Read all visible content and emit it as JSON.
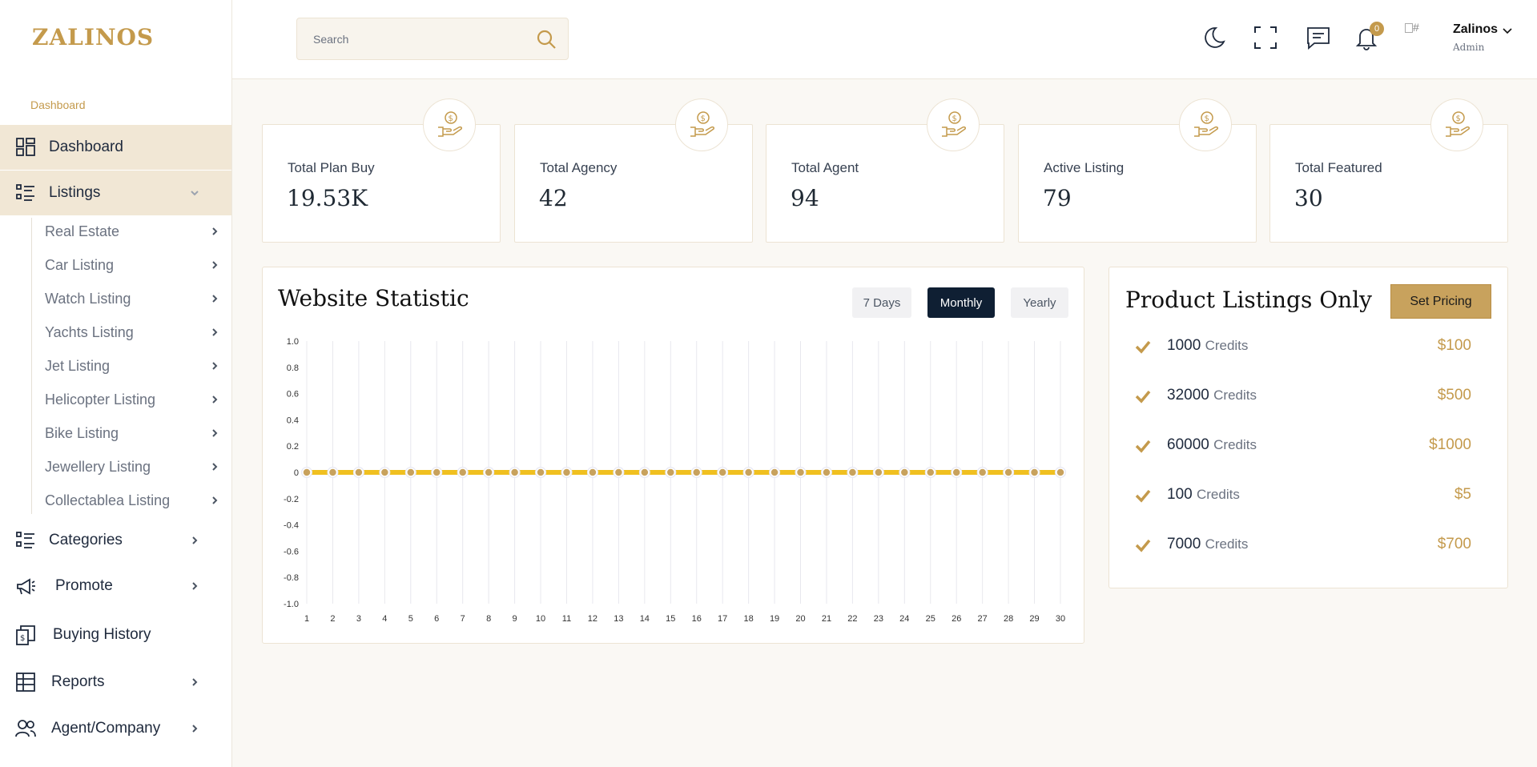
{
  "brand": {
    "logo_text": "ZALINOS"
  },
  "sidebar": {
    "section_label": "Dashboard",
    "items": [
      {
        "label": "Dashboard",
        "icon": "dashboard-grid-icon"
      },
      {
        "label": "Listings",
        "icon": "list-icon"
      },
      {
        "label": "Categories",
        "icon": "list-icon"
      },
      {
        "label": "Promote",
        "icon": "megaphone-icon"
      },
      {
        "label": "Buying History",
        "icon": "receipt-icon"
      },
      {
        "label": "Reports",
        "icon": "table-icon"
      },
      {
        "label": "Agent/Company",
        "icon": "users-icon"
      }
    ],
    "sub_items": [
      "Real Estate",
      "Car Listing",
      "Watch Listing",
      "Yachts Listing",
      "Jet Listing",
      "Helicopter Listing",
      "Bike Listing",
      "Jewellery Listing",
      "Collectablea Listing"
    ]
  },
  "header": {
    "search_placeholder": "Search",
    "notification_count": "0",
    "avatar_alt": "#",
    "user_name": "Zalinos",
    "user_role": "Admin"
  },
  "stats": [
    {
      "label": "Total Plan Buy",
      "value": "19.53K"
    },
    {
      "label": "Total Agency",
      "value": "42"
    },
    {
      "label": "Total Agent",
      "value": "94"
    },
    {
      "label": "Active Listing",
      "value": "79"
    },
    {
      "label": "Total Featured",
      "value": "30"
    }
  ],
  "statistic": {
    "title": "Website Statistic",
    "tabs": [
      "7 Days",
      "Monthly",
      "Yearly"
    ],
    "active_tab": "Monthly"
  },
  "chart_data": {
    "type": "line",
    "title": "",
    "xlabel": "",
    "ylabel": "",
    "x": [
      1,
      2,
      3,
      4,
      5,
      6,
      7,
      8,
      9,
      10,
      11,
      12,
      13,
      14,
      15,
      16,
      17,
      18,
      19,
      20,
      21,
      22,
      23,
      24,
      25,
      26,
      27,
      28,
      29,
      30
    ],
    "series": [
      {
        "values": [
          0,
          0,
          0,
          0,
          0,
          0,
          0,
          0,
          0,
          0,
          0,
          0,
          0,
          0,
          0,
          0,
          0,
          0,
          0,
          0,
          0,
          0,
          0,
          0,
          0,
          0,
          0,
          0,
          0,
          0
        ],
        "color": "#f0c020"
      }
    ],
    "yticks": [
      "1.0",
      "0.8",
      "0.6",
      "0.4",
      "0.2",
      "0",
      "-0.2",
      "-0.4",
      "-0.6",
      "-0.8",
      "-1.0"
    ],
    "ylim": [
      -1,
      1
    ],
    "grid": "vertical"
  },
  "listings": {
    "title": "Product Listings Only",
    "button_label": "Set Pricing",
    "credits_word": "Credits",
    "rows": [
      {
        "amount": "1000",
        "price": "$100"
      },
      {
        "amount": "32000",
        "price": "$500"
      },
      {
        "amount": "60000",
        "price": "$1000"
      },
      {
        "amount": "100",
        "price": "$5"
      },
      {
        "amount": "7000",
        "price": "$700"
      }
    ]
  },
  "colors": {
    "accent": "#c49a4c",
    "dark": "#0f1f33",
    "line": "#f0c020"
  }
}
